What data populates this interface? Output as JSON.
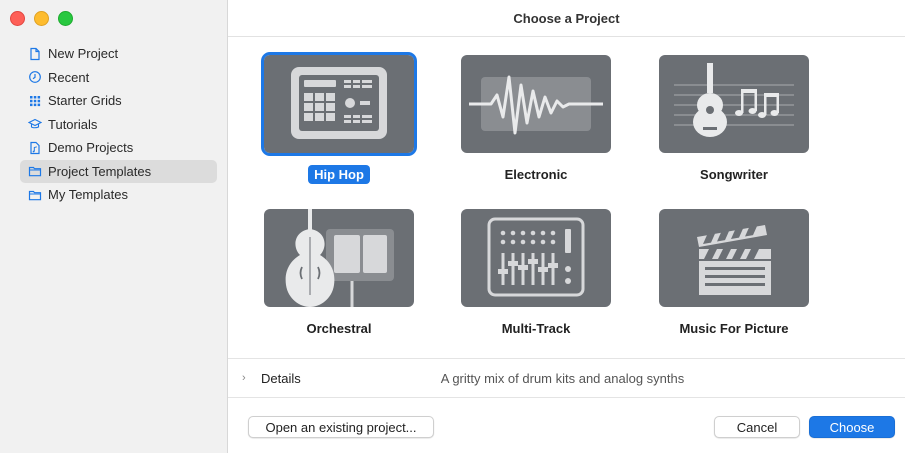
{
  "window": {
    "title": "Choose a Project"
  },
  "sidebar": {
    "items": [
      {
        "label": "New Project",
        "icon": "document-icon"
      },
      {
        "label": "Recent",
        "icon": "clock-icon"
      },
      {
        "label": "Starter Grids",
        "icon": "grid-icon"
      },
      {
        "label": "Tutorials",
        "icon": "graduation-cap-icon"
      },
      {
        "label": "Demo Projects",
        "icon": "document-music-icon"
      },
      {
        "label": "Project Templates",
        "icon": "folder-icon",
        "selected": true
      },
      {
        "label": "My Templates",
        "icon": "folder-icon"
      }
    ]
  },
  "templates": [
    {
      "label": "Hip Hop",
      "icon": "drum-machine-icon",
      "selected": true
    },
    {
      "label": "Electronic",
      "icon": "waveform-icon"
    },
    {
      "label": "Songwriter",
      "icon": "guitar-icon"
    },
    {
      "label": "Orchestral",
      "icon": "double-bass-icon"
    },
    {
      "label": "Multi-Track",
      "icon": "mixer-icon"
    },
    {
      "label": "Music For Picture",
      "icon": "clapperboard-icon"
    }
  ],
  "details": {
    "label": "Details",
    "description": "A gritty mix of drum kits and analog synths"
  },
  "footer": {
    "open_existing": "Open an existing project...",
    "cancel": "Cancel",
    "choose": "Choose"
  },
  "colors": {
    "accent": "#1d78e6",
    "thumb_bg": "#6b6f74",
    "sidebar_bg": "#f1f1f1"
  }
}
